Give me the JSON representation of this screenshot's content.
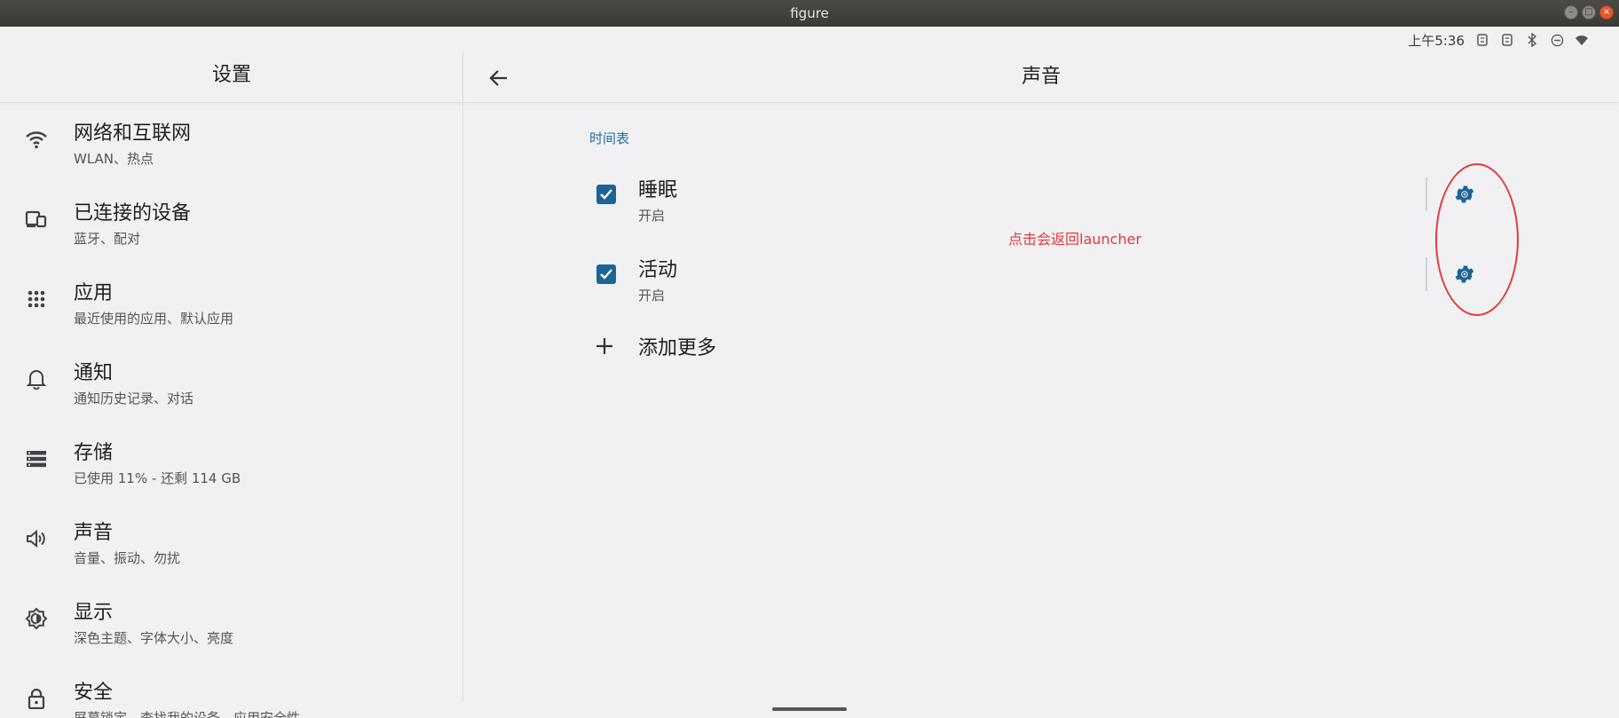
{
  "window": {
    "title": "figure"
  },
  "statusbar": {
    "time": "上午5:36"
  },
  "left": {
    "header": "设置",
    "items": [
      {
        "title": "网络和互联网",
        "subtitle": "WLAN、热点",
        "icon": "wifi-icon"
      },
      {
        "title": "已连接的设备",
        "subtitle": "蓝牙、配对",
        "icon": "devices-icon"
      },
      {
        "title": "应用",
        "subtitle": "最近使用的应用、默认应用",
        "icon": "apps-grid-icon"
      },
      {
        "title": "通知",
        "subtitle": "通知历史记录、对话",
        "icon": "bell-icon"
      },
      {
        "title": "存储",
        "subtitle": "已使用 11% - 还剩 114 GB",
        "icon": "storage-icon"
      },
      {
        "title": "声音",
        "subtitle": "音量、振动、勿扰",
        "icon": "speaker-icon"
      },
      {
        "title": "显示",
        "subtitle": "深色主题、字体大小、亮度",
        "icon": "brightness-icon"
      },
      {
        "title": "安全",
        "subtitle": "屏幕锁定、查找我的设备、应用安全性",
        "icon": "lock-icon"
      }
    ]
  },
  "right": {
    "title": "声音",
    "section_label": "时间表",
    "schedules": [
      {
        "title": "睡眠",
        "status": "开启",
        "checked": true
      },
      {
        "title": "活动",
        "status": "开启",
        "checked": true
      }
    ],
    "add_more": "添加更多"
  },
  "annotation": {
    "text": "点击会返回launcher",
    "color": "#e03a3a"
  },
  "colors": {
    "accent": "#1a6496",
    "background": "#f1f1f4"
  }
}
